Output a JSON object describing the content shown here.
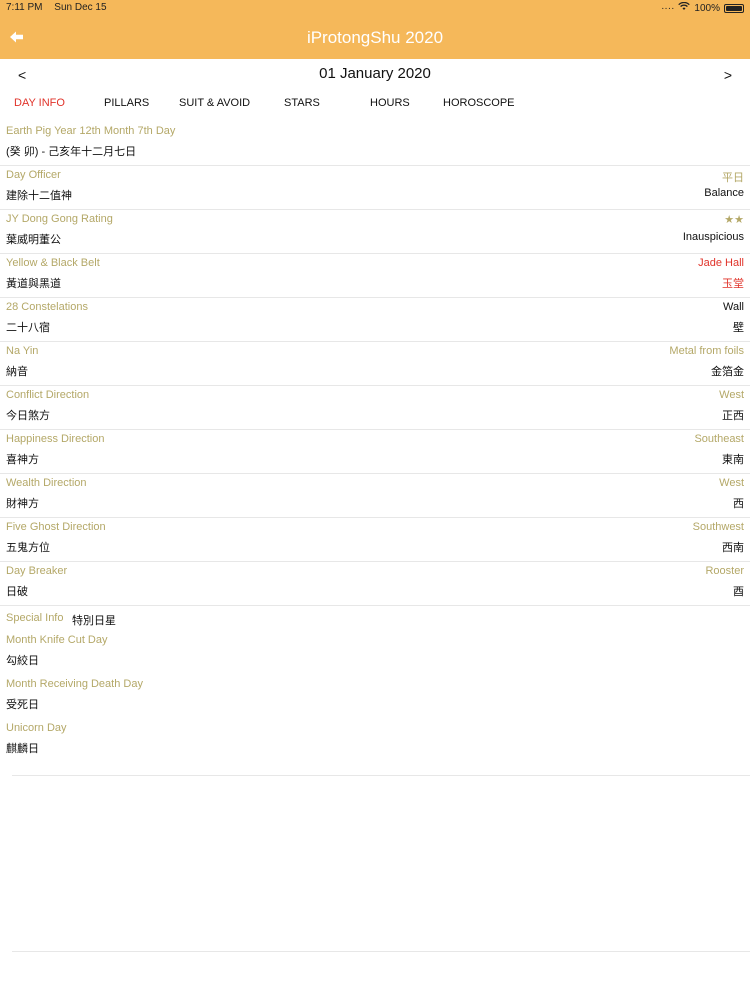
{
  "status_bar": {
    "time": "7:11 PM",
    "date": "Sun Dec 15",
    "battery": "100%",
    "icons": [
      "signal-dots-icon",
      "wifi-icon",
      "battery-icon"
    ]
  },
  "nav": {
    "title": "iProtongShu 2020",
    "back_icon": "back-arrow-icon",
    "accent": "#f5b85a"
  },
  "date_bar": {
    "prev": "<",
    "date": "01 January 2020",
    "next": ">"
  },
  "tabs": [
    {
      "label": "DAY INFO",
      "active": true
    },
    {
      "label": "PILLARS"
    },
    {
      "label": "SUIT & AVOID"
    },
    {
      "label": "STARS"
    },
    {
      "label": "HOURS"
    },
    {
      "label": "HOROSCOPE"
    }
  ],
  "rows": [
    {
      "en": "Earth Pig Year 12th Month 7th Day",
      "cn": "(癸 卯) - 己亥年十二月七日",
      "value_en": "",
      "value_cn": ""
    },
    {
      "en": "Day Officer",
      "cn": "建除十二值神",
      "value_en": "平日",
      "value_cn": "Balance"
    },
    {
      "en": "JY Dong Gong Rating",
      "cn": "葉威明董公",
      "value_en": "★★",
      "value_cn": "Inauspicious"
    },
    {
      "en": "Yellow & Black Belt",
      "cn": "黃道與黑道",
      "value_en": "Jade Hall",
      "value_cn": "玉堂"
    },
    {
      "en": "28 Constelations",
      "cn": "二十八宿",
      "value_en": "Wall",
      "value_cn": "壁"
    },
    {
      "en": "Na Yin",
      "cn": "納音",
      "value_en": "Metal from foils",
      "value_cn": "金箔金"
    },
    {
      "en": "Conflict Direction",
      "cn": "今日煞方",
      "value_en": "West",
      "value_cn": "正西"
    },
    {
      "en": "Happiness Direction",
      "cn": "喜神方",
      "value_en": "Southeast",
      "value_cn": "東南"
    },
    {
      "en": "Wealth Direction",
      "cn": "財神方",
      "value_en": "West",
      "value_cn": "西"
    },
    {
      "en": "Five Ghost Direction",
      "cn": "五鬼方位",
      "value_en": "Southwest",
      "value_cn": "西南"
    },
    {
      "en": "Day Breaker",
      "cn": "日破",
      "value_en": "Rooster",
      "value_cn": "酉"
    }
  ],
  "special_info": {
    "label": "Special Info",
    "value": "特別日星",
    "items": [
      {
        "en": "Month Knife Cut Day",
        "cn": "勾絞日"
      },
      {
        "en": "Month Receiving Death Day",
        "cn": "受死日"
      },
      {
        "en": "Unicorn Day",
        "cn": "麒麟日"
      }
    ]
  },
  "colors": {
    "header": "#f5b85a",
    "label_olive": "#b4a868",
    "highlight_red": "#e0332a"
  }
}
